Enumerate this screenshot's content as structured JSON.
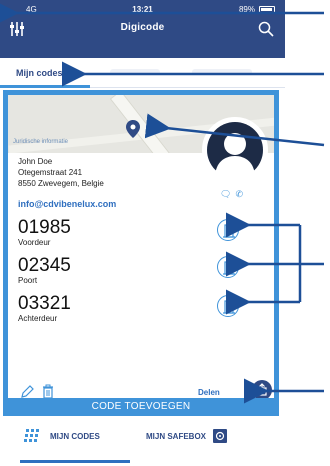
{
  "status_bar": {
    "carrier": "4G",
    "time": "13:21",
    "battery": "89%"
  },
  "header": {
    "logo": "Digicode",
    "icons": [
      "settings-sliders-icon",
      "search-icon"
    ]
  },
  "tabs": [
    {
      "label": "Mijn codes",
      "active": true
    },
    {
      "label": "",
      "active": false
    },
    {
      "label": "",
      "active": false
    }
  ],
  "card": {
    "map_attribution": "Juridische informatie",
    "name": "John Doe",
    "address_line1": "Otegemstraat 241",
    "address_line2": "8550 Zwevegem, Belgie",
    "email": "info@cdvibenelux.com",
    "codes": [
      {
        "code": "01985",
        "label": "Voordeur"
      },
      {
        "code": "02345",
        "label": "Poort"
      },
      {
        "code": "03321",
        "label": "Achterdeur"
      }
    ],
    "share_label": "Delen",
    "add_code_label": "CODE TOEVOEGEN"
  },
  "bottom_nav": {
    "codes_label": "MIJN CODES",
    "safebox_label": "MIJN SAFEBOX"
  },
  "colors": {
    "header": "#2f4a85",
    "accent": "#3f93d9",
    "link": "#2f6fbf",
    "arrow": "#1d4f97"
  }
}
